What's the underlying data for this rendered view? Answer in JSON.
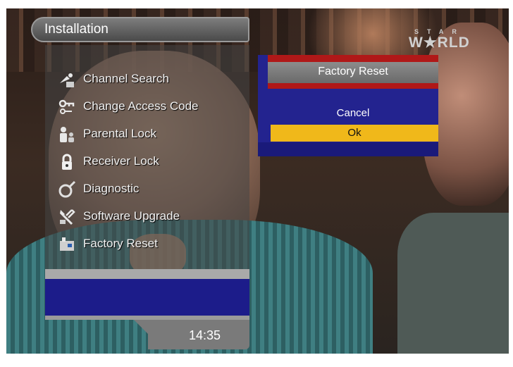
{
  "menu": {
    "title": "Installation",
    "items": [
      {
        "label": "Channel Search",
        "icon": "satellite-dish-icon"
      },
      {
        "label": "Change Access Code",
        "icon": "key-icon"
      },
      {
        "label": "Parental Lock",
        "icon": "parental-icon"
      },
      {
        "label": "Receiver Lock",
        "icon": "padlock-icon"
      },
      {
        "label": "Diagnostic",
        "icon": "diagnostic-icon"
      },
      {
        "label": "Software Upgrade",
        "icon": "tools-icon"
      },
      {
        "label": "Factory Reset",
        "icon": "factory-reset-icon"
      }
    ]
  },
  "clock": "14:35",
  "logo": {
    "small": "STAR",
    "big": "W★RLD"
  },
  "dialog": {
    "title": "Factory Reset",
    "options": [
      "Cancel",
      "Ok"
    ],
    "selected": "Ok"
  },
  "colors": {
    "accent_selected": "#f0b81a",
    "dialog_blue": "#23238f",
    "dialog_red": "#b01818"
  }
}
